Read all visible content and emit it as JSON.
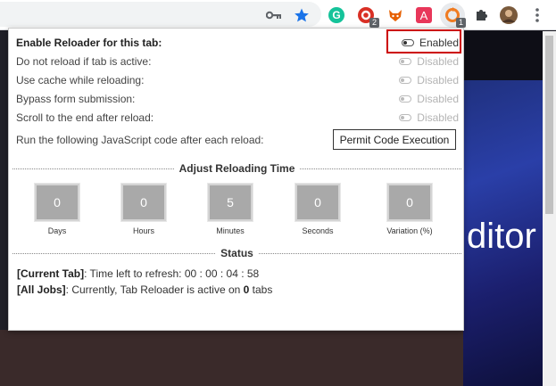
{
  "toolbar": {
    "extensions": [
      {
        "name": "grammarly",
        "color": "#15c39a",
        "glyph": "G",
        "badge": ""
      },
      {
        "name": "red-ext",
        "color": "#d93025",
        "glyph": "O",
        "badge": "2"
      },
      {
        "name": "firefox-ext",
        "color": "#e66000",
        "glyph": "●",
        "badge": ""
      },
      {
        "name": "a-ext",
        "color": "#e8375a",
        "glyph": "A",
        "badge": ""
      },
      {
        "name": "tab-reloader",
        "color": "#f07c22",
        "glyph": "↻",
        "badge": "1"
      }
    ]
  },
  "popup": {
    "main_label": "Enable Reloader for this tab:",
    "main_state": "Enabled",
    "options": [
      {
        "label": "Do not reload if tab is active:",
        "state": "Disabled"
      },
      {
        "label": "Use cache while reloading:",
        "state": "Disabled"
      },
      {
        "label": "Bypass form submission:",
        "state": "Disabled"
      },
      {
        "label": "Scroll to the end after reload:",
        "state": "Disabled"
      }
    ],
    "js_label": "Run the following JavaScript code after each reload:",
    "permit_button": "Permit Code Execution",
    "time_section": "Adjust Reloading Time",
    "time": [
      {
        "value": "0",
        "label": "Days"
      },
      {
        "value": "0",
        "label": "Hours"
      },
      {
        "value": "5",
        "label": "Minutes"
      },
      {
        "value": "0",
        "label": "Seconds"
      },
      {
        "value": "0",
        "label": "Variation (%)"
      }
    ],
    "status_section": "Status",
    "status_current_key": "[Current Tab]",
    "status_current_text": ": Time left to refresh: 00 : 00 : 04 : 58",
    "status_jobs_key": "[All Jobs]",
    "status_jobs_text": ": Currently, Tab Reloader is active on ",
    "status_jobs_count": "0",
    "status_jobs_suffix": " tabs"
  },
  "background": {
    "partial_word": "ditor"
  },
  "colors": {
    "highlight": "#cc0000",
    "tile": "#a9a9a9"
  }
}
